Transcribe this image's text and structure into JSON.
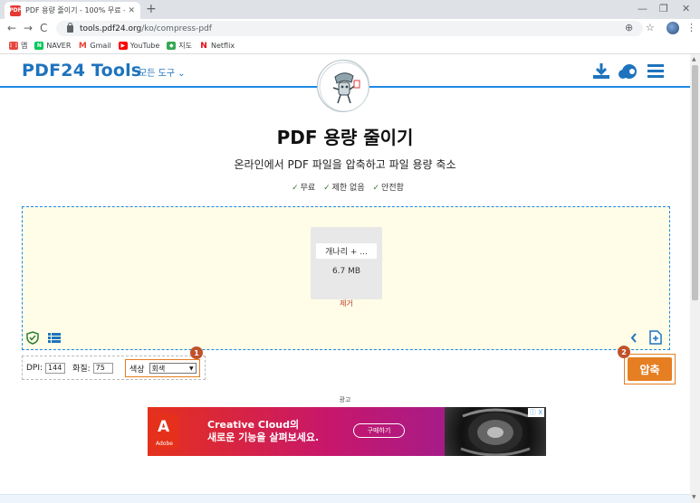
{
  "browser": {
    "tab": {
      "title": "PDF 용량 줄이기 - 100% 무료 -",
      "favicon_text": "PDF24"
    },
    "url": {
      "host": "tools.pdf24.org",
      "path": "/ko/compress-pdf"
    },
    "bookmarks": [
      {
        "label": "앱",
        "icon": "apps-grid-icon",
        "color": "#e8453c"
      },
      {
        "label": "NAVER",
        "icon": "naver-icon",
        "color": "#03c75a"
      },
      {
        "label": "Gmail",
        "icon": "gmail-icon",
        "color": "#ea4335"
      },
      {
        "label": "YouTube",
        "icon": "youtube-icon",
        "color": "#ff0000"
      },
      {
        "label": "지도",
        "icon": "maps-icon",
        "color": "#34a853"
      },
      {
        "label": "Netflix",
        "icon": "netflix-icon",
        "color": "#e50914"
      }
    ]
  },
  "header": {
    "logo": "PDF24 Tools",
    "all_tools": "모든 도구",
    "accent_color": "#1e73be"
  },
  "main": {
    "title": "PDF 용량 줄이기",
    "subtitle": "온라인에서 PDF 파일을 압축하고 파일 용량 축소",
    "features": [
      "무료",
      "제한 없음",
      "안전함"
    ]
  },
  "file": {
    "name": "개나리 + ...",
    "size": "6.7 MB",
    "remove": "제거"
  },
  "options": {
    "dpi_label": "DPI:",
    "dpi_value": "144",
    "quality_label": "화질:",
    "quality_value": "75",
    "color_label": "색상",
    "color_value": "회색",
    "badge1": "1",
    "badge2": "2"
  },
  "actions": {
    "compress": "압축",
    "compress_color": "#e67e22"
  },
  "ad": {
    "label": "광고",
    "brand": "Adobe",
    "line1": "Creative Cloud의",
    "line2": "새로운 기능을 살펴보세요.",
    "cta": "구매하기",
    "close": "ⓘ X"
  }
}
